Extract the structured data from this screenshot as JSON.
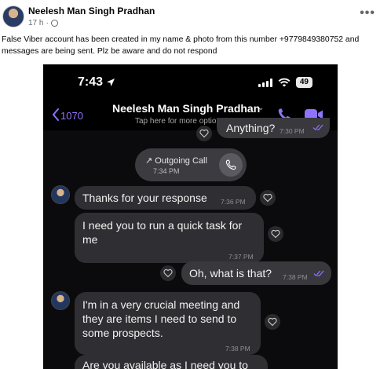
{
  "post": {
    "author": "Neelesh Man Singh Pradhan",
    "time": "17 h",
    "more_icon": "more-horizontal-icon",
    "text": "False Viber account has been created in my  name & photo from this number +9779849380752 and messages are being sent. Plz be aware and do not respond"
  },
  "status_bar": {
    "time": "7:43",
    "battery": "49"
  },
  "chat_header": {
    "back_count": "1070",
    "contact_name": "Neelesh Man Singh Pradhan",
    "subtitle": "Tap here for more options"
  },
  "top_cut": {
    "text": "Anything?",
    "time": "7:30 PM"
  },
  "call": {
    "label": "Outgoing Call",
    "time": "7:34 PM"
  },
  "messages": [
    {
      "direction": "in",
      "text": "Thanks for your response",
      "time": "7:36 PM"
    },
    {
      "direction": "in",
      "text": "I need you to run a quick task for me",
      "time": "7:37 PM"
    },
    {
      "direction": "out",
      "text": "Oh, what is that?",
      "time": "7:38 PM"
    },
    {
      "direction": "in",
      "text": "I'm in a very crucial meeting and they are items I need to send to some prospects.",
      "time": "7:38 PM"
    },
    {
      "direction": "in",
      "text": "Are you available as I need you to",
      "time": ""
    }
  ],
  "colors": {
    "viber_purple": "#7b61ff",
    "read_tick": "#8f73ff",
    "bubble": "#2f2f33",
    "background": "#0b0b0d"
  }
}
